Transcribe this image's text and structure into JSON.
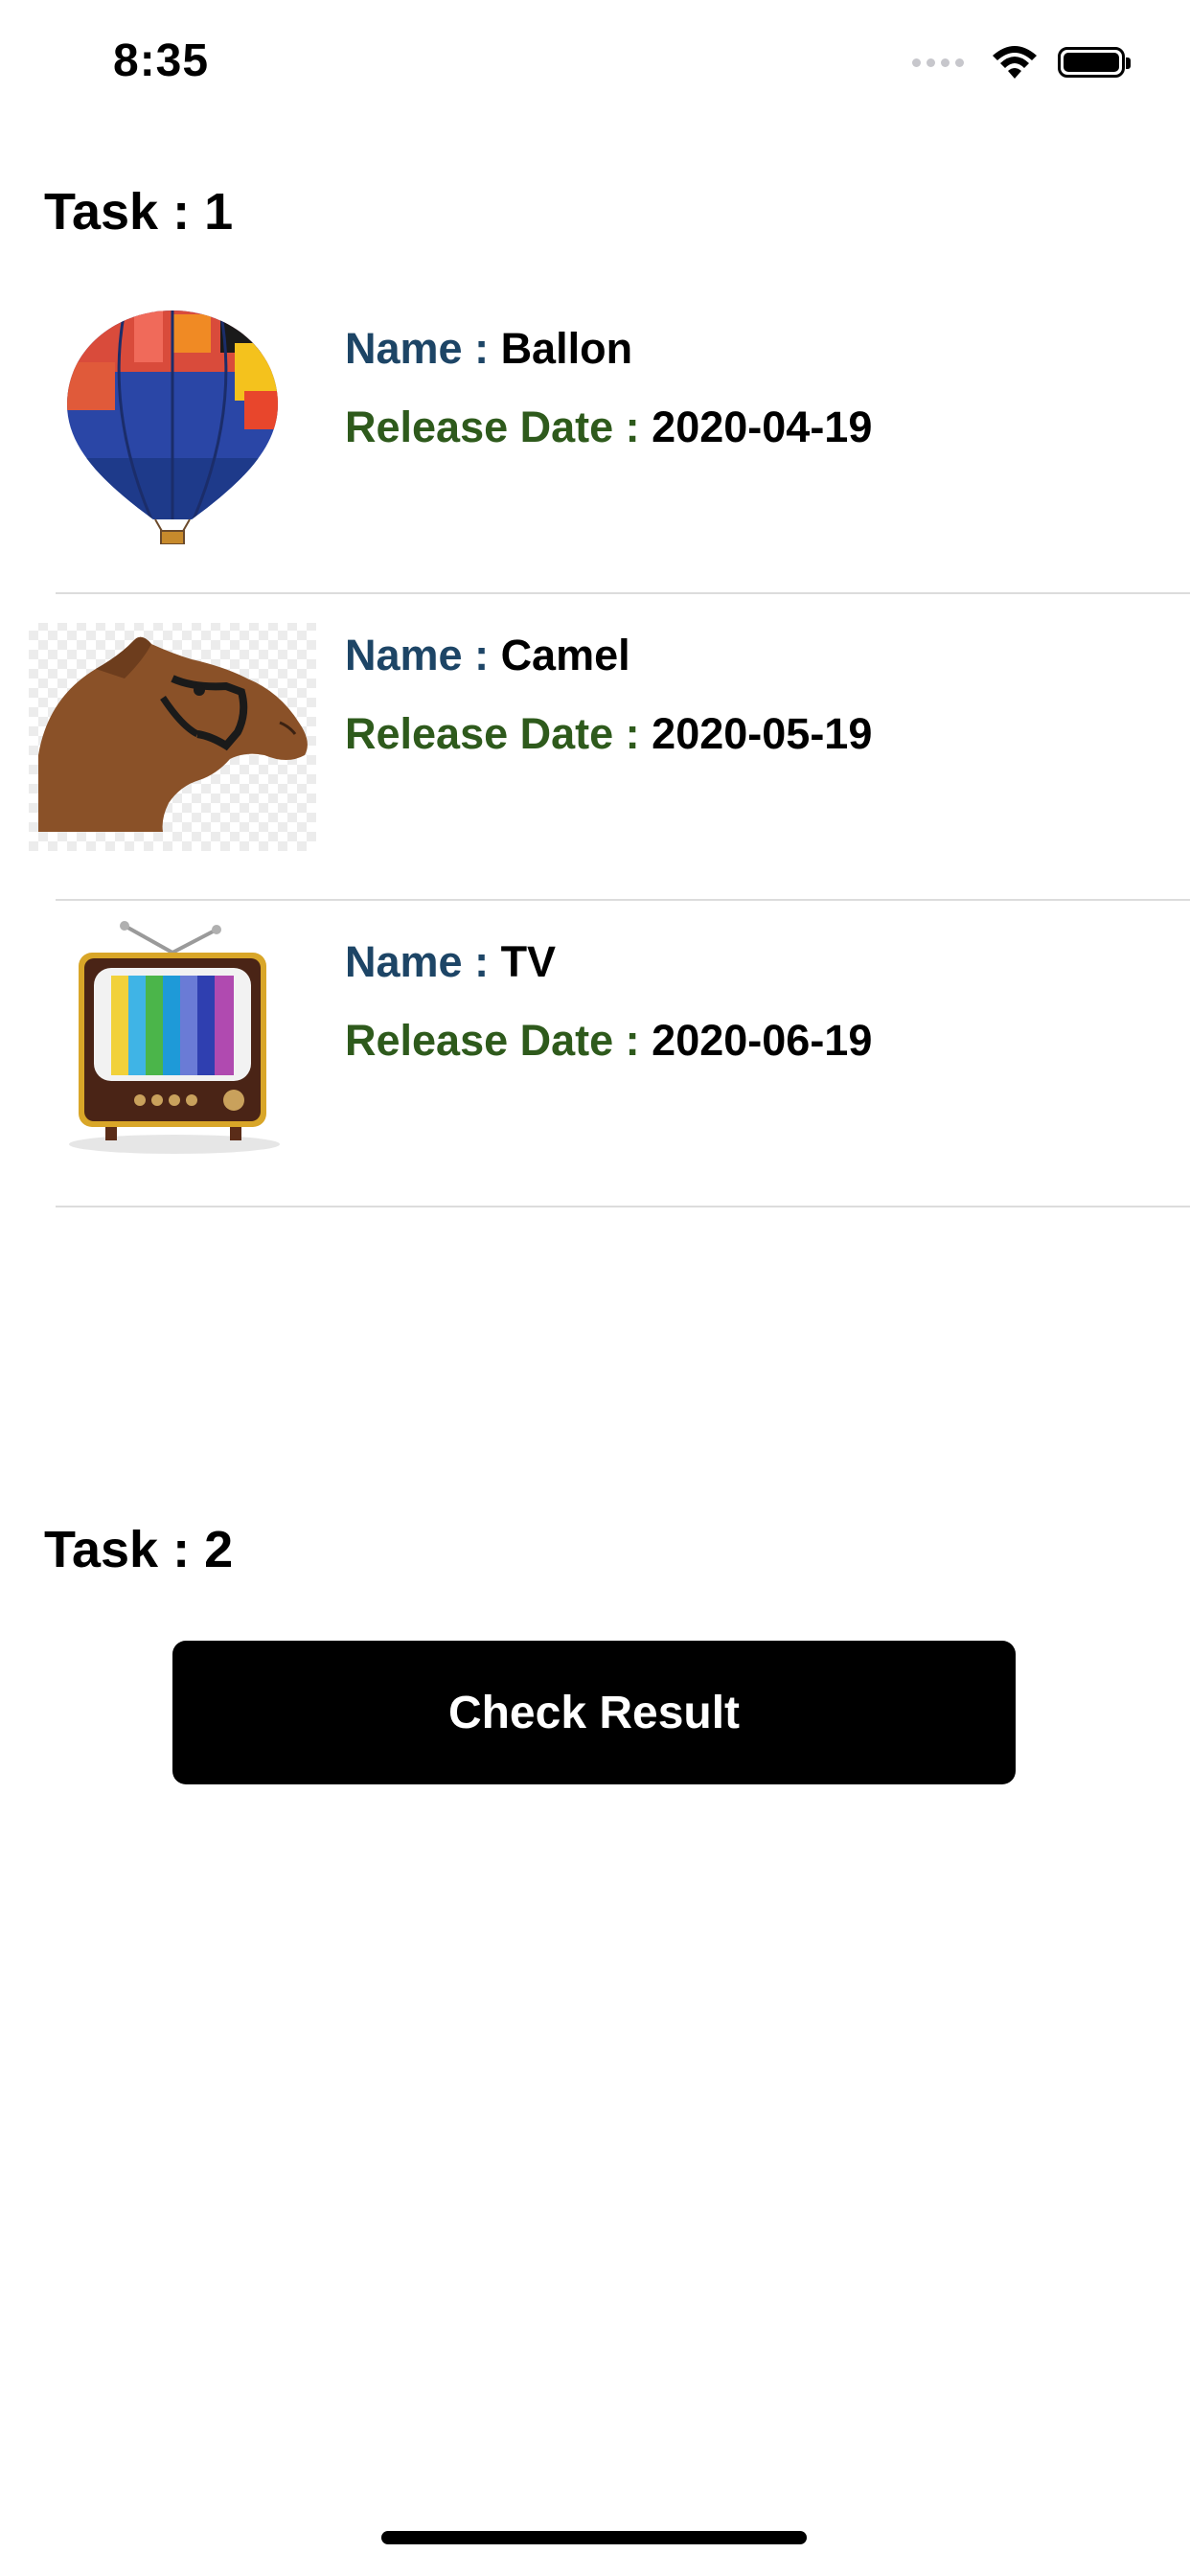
{
  "status_bar": {
    "time": "8:35",
    "icons": [
      "signal-dots-icon",
      "wifi-icon",
      "battery-icon"
    ]
  },
  "task1": {
    "title": "Task : 1",
    "items": [
      {
        "name_label": "Name : ",
        "name": "Ballon",
        "date_label": "Release Date : ",
        "date": "2020-04-19",
        "image": "hot-air-balloon-image"
      },
      {
        "name_label": "Name : ",
        "name": "Camel",
        "date_label": "Release Date : ",
        "date": "2020-05-19",
        "image": "camel-image"
      },
      {
        "name_label": "Name : ",
        "name": "TV",
        "date_label": "Release Date : ",
        "date": "2020-06-19",
        "image": "retro-tv-image"
      }
    ]
  },
  "task2": {
    "title": "Task : 2",
    "button_label": "Check Result"
  },
  "colors": {
    "name_label": "#1d4566",
    "date_label": "#2e5a1c",
    "button_bg": "#000000",
    "button_text": "#ffffff",
    "separator": "#dcdcdc"
  }
}
